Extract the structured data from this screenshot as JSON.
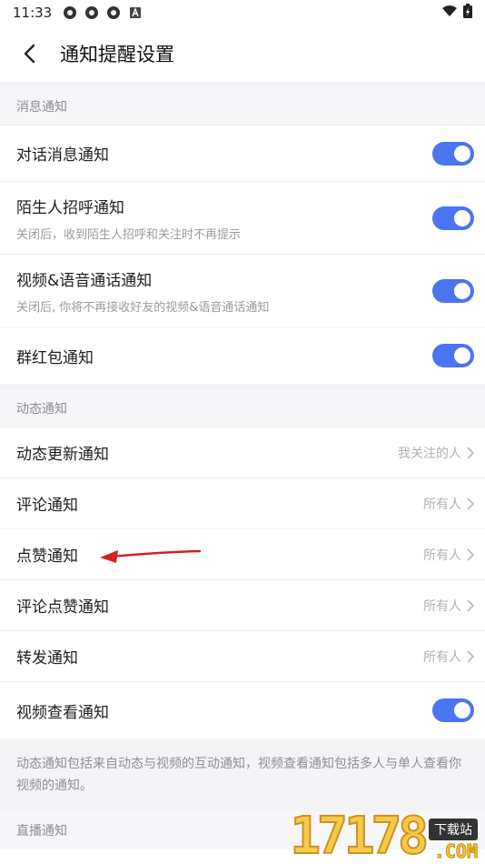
{
  "status": {
    "time": "11:33"
  },
  "header": {
    "title": "通知提醒设置"
  },
  "sections": {
    "message": {
      "title": "消息通知",
      "rows": [
        {
          "label": "对话消息通知",
          "sub": ""
        },
        {
          "label": "陌生人招呼通知",
          "sub": "关闭后，收到陌生人招呼和关注时不再提示"
        },
        {
          "label": "视频&语音通话通知",
          "sub": "关闭后, 你将不再接收好友的视频&语音通话通知"
        },
        {
          "label": "群红包通知",
          "sub": ""
        }
      ]
    },
    "dynamic": {
      "title": "动态通知",
      "rows": [
        {
          "label": "动态更新通知",
          "value": "我关注的人"
        },
        {
          "label": "评论通知",
          "value": "所有人"
        },
        {
          "label": "点赞通知",
          "value": "所有人"
        },
        {
          "label": "评论点赞通知",
          "value": "所有人"
        },
        {
          "label": "转发通知",
          "value": "所有人"
        },
        {
          "label": "视频查看通知",
          "value": ""
        }
      ],
      "note": "动态通知包括来自动态与视频的互动通知，视频查看通知包括多人与单人查看你视频的通知。"
    },
    "live": {
      "title": "直播通知"
    }
  },
  "watermark": {
    "number": "17178",
    "tag": "下载站",
    "domain": ".COM"
  },
  "colors": {
    "toggle_on": "#4a74f0",
    "annotation_arrow": "#d42020"
  }
}
